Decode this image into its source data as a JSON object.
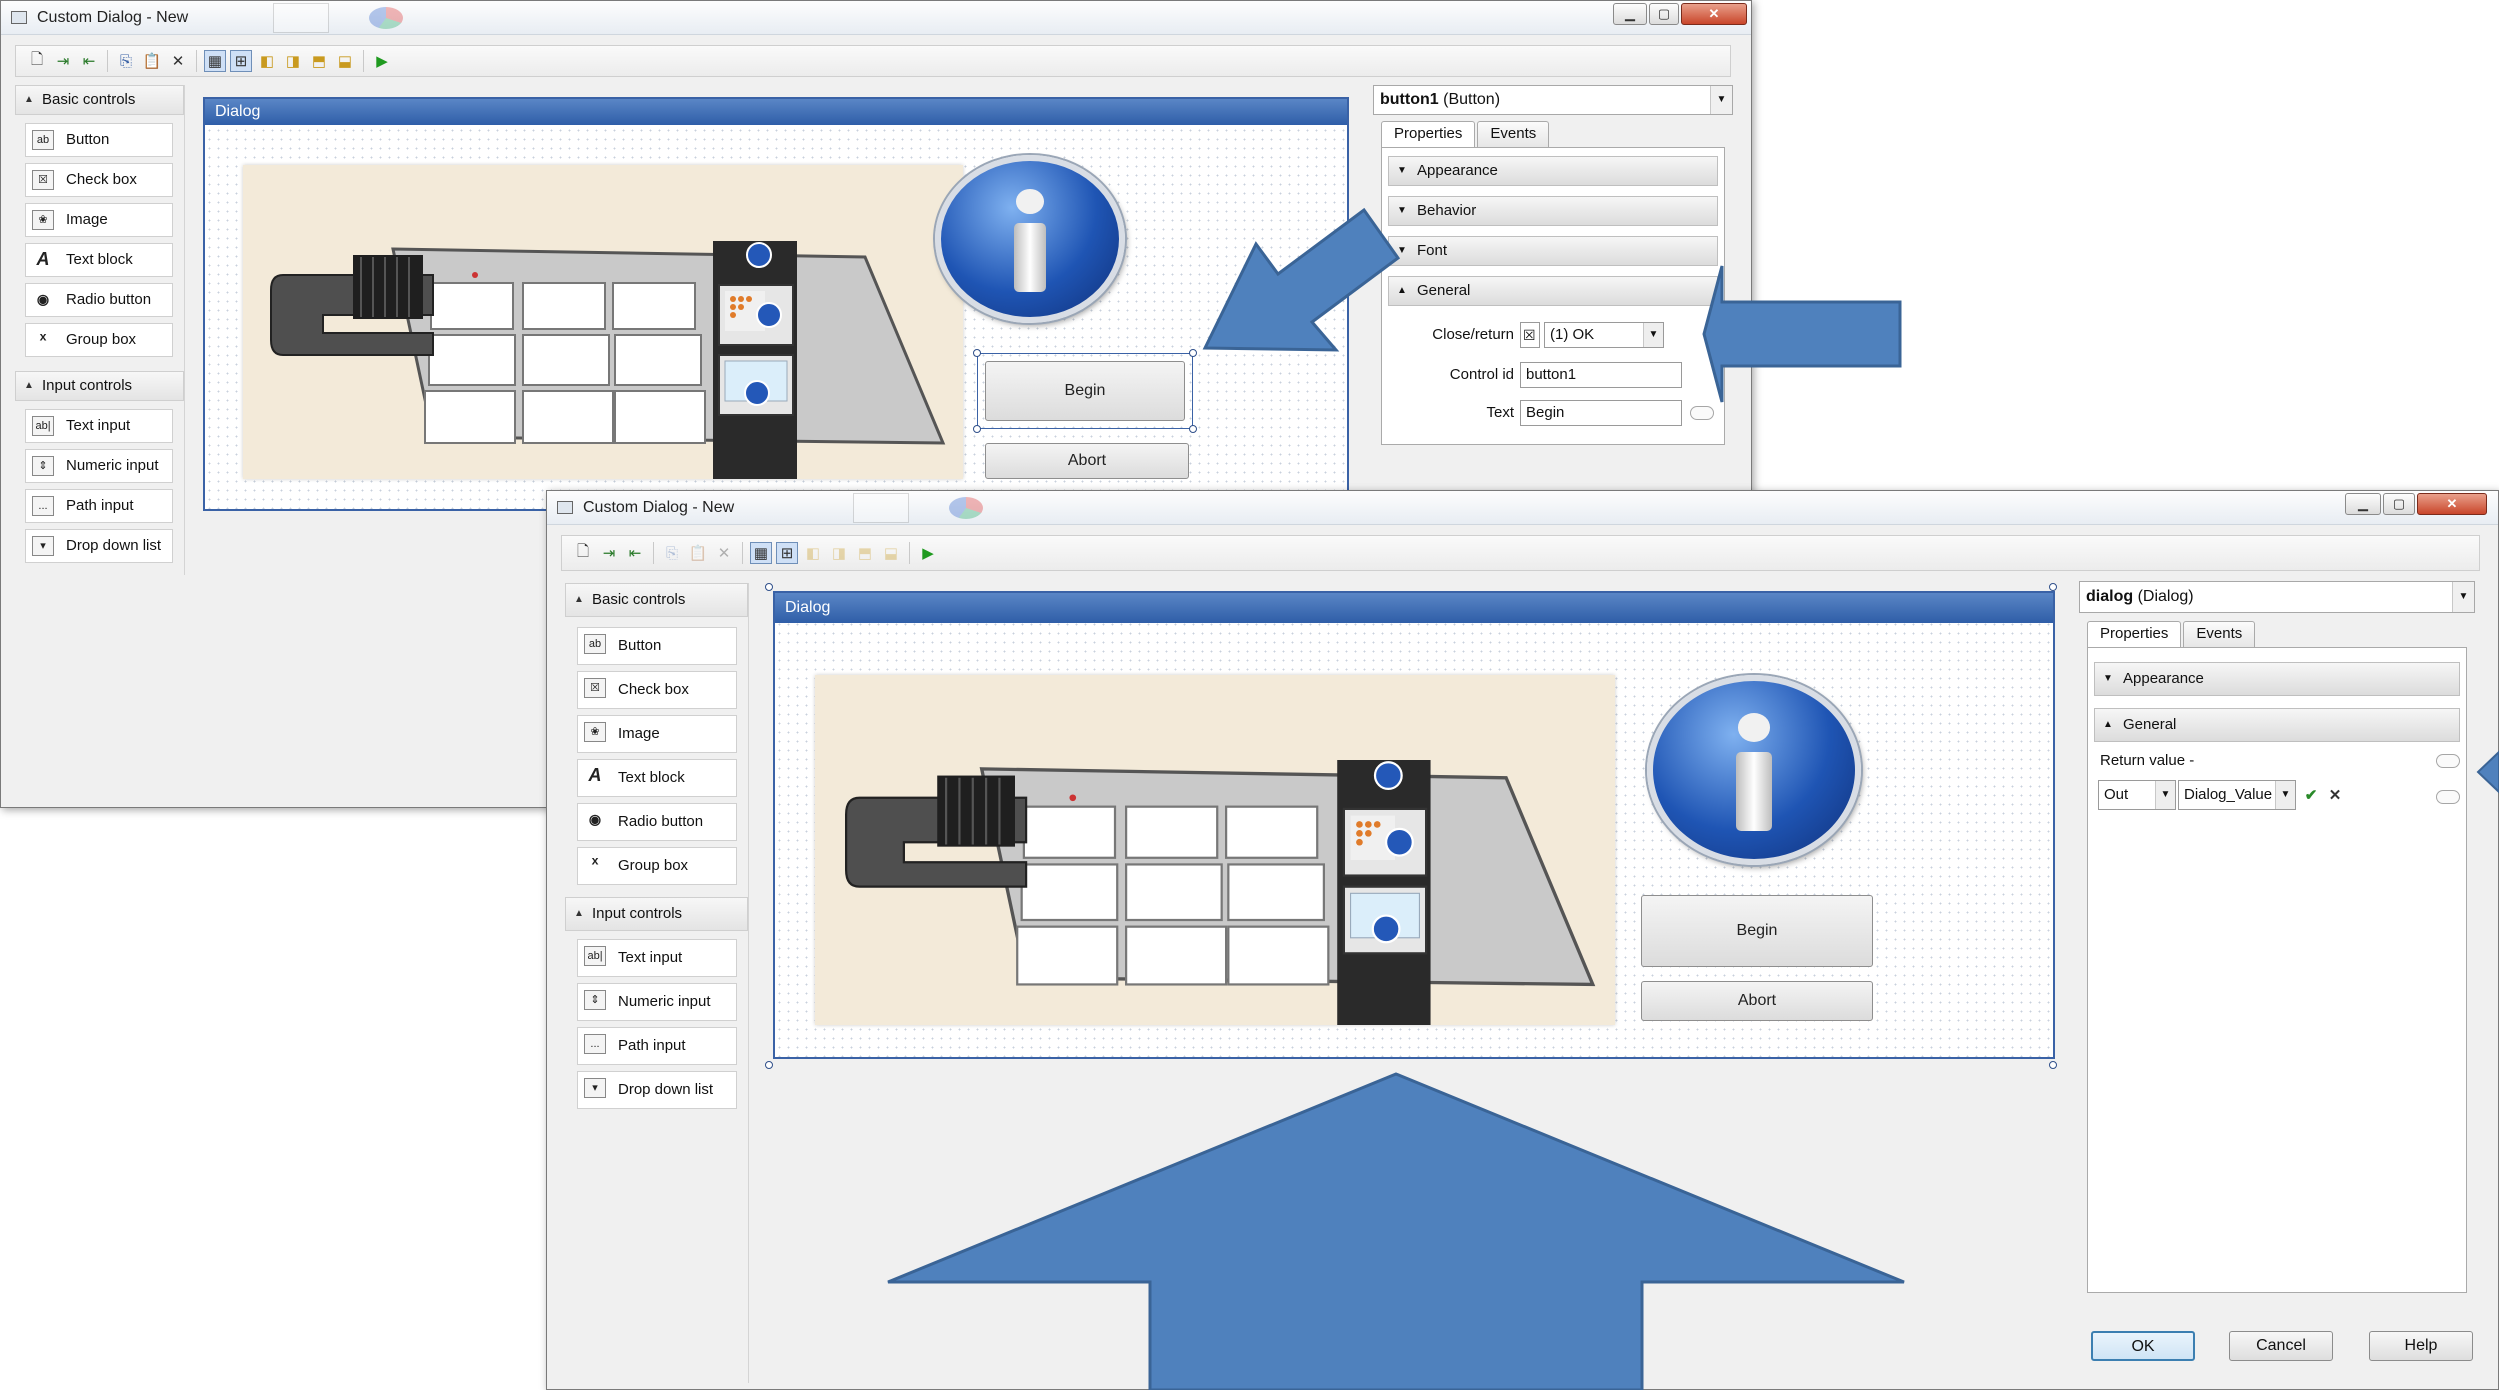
{
  "windows": [
    {
      "title": "Custom Dialog - New",
      "window_buttons": [
        "▁",
        "▢",
        "✕"
      ],
      "toolbox": {
        "groups": [
          {
            "label": "Basic controls",
            "items": [
              {
                "icon": "ab",
                "label": "Button"
              },
              {
                "icon": "☒",
                "label": "Check box"
              },
              {
                "icon": "❀",
                "label": "Image"
              },
              {
                "icon": "A",
                "label": "Text block"
              },
              {
                "icon": "◉",
                "label": "Radio button"
              },
              {
                "icon": "ˣ",
                "label": "Group box"
              }
            ]
          },
          {
            "label": "Input controls",
            "items": [
              {
                "icon": "ab|",
                "label": "Text input"
              },
              {
                "icon": "⇕",
                "label": "Numeric input"
              },
              {
                "icon": "...",
                "label": "Path input"
              },
              {
                "icon": "▾",
                "label": "Drop down list"
              }
            ]
          }
        ]
      },
      "designer": {
        "title": "Dialog",
        "begin": "Begin",
        "abort": "Abort"
      },
      "properties": {
        "object_name": "button1",
        "object_type": "(Button)",
        "tabs": [
          "Properties",
          "Events"
        ],
        "sections": [
          "Appearance",
          "Behavior",
          "Font",
          "General"
        ],
        "rows": [
          {
            "label": "Close/return",
            "value": "(1) OK",
            "check": "☒"
          },
          {
            "label": "Control id",
            "value": "button1"
          },
          {
            "label": "Text",
            "value": "Begin"
          }
        ]
      }
    },
    {
      "title": "Custom Dialog - New",
      "window_buttons": [
        "▁",
        "▢",
        "✕"
      ],
      "toolbox": {
        "groups": [
          {
            "label": "Basic controls",
            "items": [
              {
                "icon": "ab",
                "label": "Button"
              },
              {
                "icon": "☒",
                "label": "Check box"
              },
              {
                "icon": "❀",
                "label": "Image"
              },
              {
                "icon": "A",
                "label": "Text block"
              },
              {
                "icon": "◉",
                "label": "Radio button"
              },
              {
                "icon": "ˣ",
                "label": "Group box"
              }
            ]
          },
          {
            "label": "Input controls",
            "items": [
              {
                "icon": "ab|",
                "label": "Text input"
              },
              {
                "icon": "⇕",
                "label": "Numeric input"
              },
              {
                "icon": "...",
                "label": "Path input"
              },
              {
                "icon": "▾",
                "label": "Drop down list"
              }
            ]
          }
        ]
      },
      "designer": {
        "title": "Dialog",
        "begin": "Begin",
        "abort": "Abort"
      },
      "properties": {
        "object_name": "dialog",
        "object_type": "(Dialog)",
        "tabs": [
          "Properties",
          "Events"
        ],
        "sections": [
          "Appearance",
          "General"
        ],
        "return_label": "Return value -",
        "direction": "Out",
        "variable": "Dialog_Value"
      },
      "footer": {
        "ok": "OK",
        "cancel": "Cancel",
        "help": "Help"
      }
    }
  ],
  "colors": {
    "arrow": "#4f81bd",
    "arrow_edge": "#3a6496",
    "title_blue": "#2f5ea8"
  },
  "icons": {
    "toolbar": [
      "new-icon",
      "import-icon",
      "export-icon",
      "copy-icon",
      "paste-icon",
      "delete-icon",
      "grid-icon",
      "snap-icon",
      "align-left-icon",
      "align-right-icon",
      "align-top-icon",
      "align-bottom-icon",
      "run-icon"
    ]
  }
}
